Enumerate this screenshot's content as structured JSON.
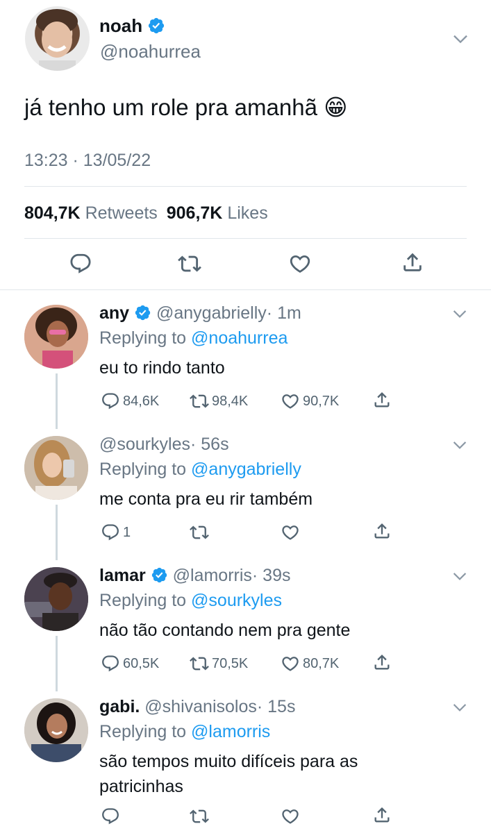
{
  "main_tweet": {
    "name": "noah",
    "handle": "@noahurrea",
    "text": "já tenho um role pra amanhã 😁",
    "timestamp": "13:23 · 13/05/22",
    "retweets_count": "804,7K",
    "retweets_label": "Retweets",
    "likes_count": "906,7K",
    "likes_label": "Likes"
  },
  "replies": [
    {
      "name": "any",
      "verified": true,
      "handle": "@anygabrielly",
      "time": "· 1m",
      "replying_label": "Replying to",
      "replying_to": "@noahurrea",
      "text": "eu to rindo tanto",
      "reply_count": "84,6K",
      "retweet_count": "98,4K",
      "like_count": "90,7K"
    },
    {
      "name": "",
      "verified": false,
      "handle": "@sourkyles",
      "time": "· 56s",
      "replying_label": "Replying to",
      "replying_to": "@anygabrielly",
      "text": "me conta pra eu rir também",
      "reply_count": "1",
      "retweet_count": "",
      "like_count": ""
    },
    {
      "name": "lamar",
      "verified": true,
      "handle": "@lamorris",
      "time": "· 39s",
      "replying_label": "Replying to",
      "replying_to": "@sourkyles",
      "text": "não tão contando nem pra gente",
      "reply_count": "60,5K",
      "retweet_count": "70,5K",
      "like_count": "80,7K"
    },
    {
      "name": "gabi.",
      "verified": false,
      "handle": "@shivanisolos",
      "time": "· 15s",
      "replying_label": "Replying to",
      "replying_to": "@lamorris",
      "text_line1": "são tempos muito difíceis para as",
      "text_line2": "patricinhas",
      "reply_count": "",
      "retweet_count": "",
      "like_count": ""
    }
  ],
  "colors": {
    "accent": "#1d9bf0",
    "text": "#0f1419",
    "secondary": "#687684",
    "divider": "#e1e6ea"
  }
}
